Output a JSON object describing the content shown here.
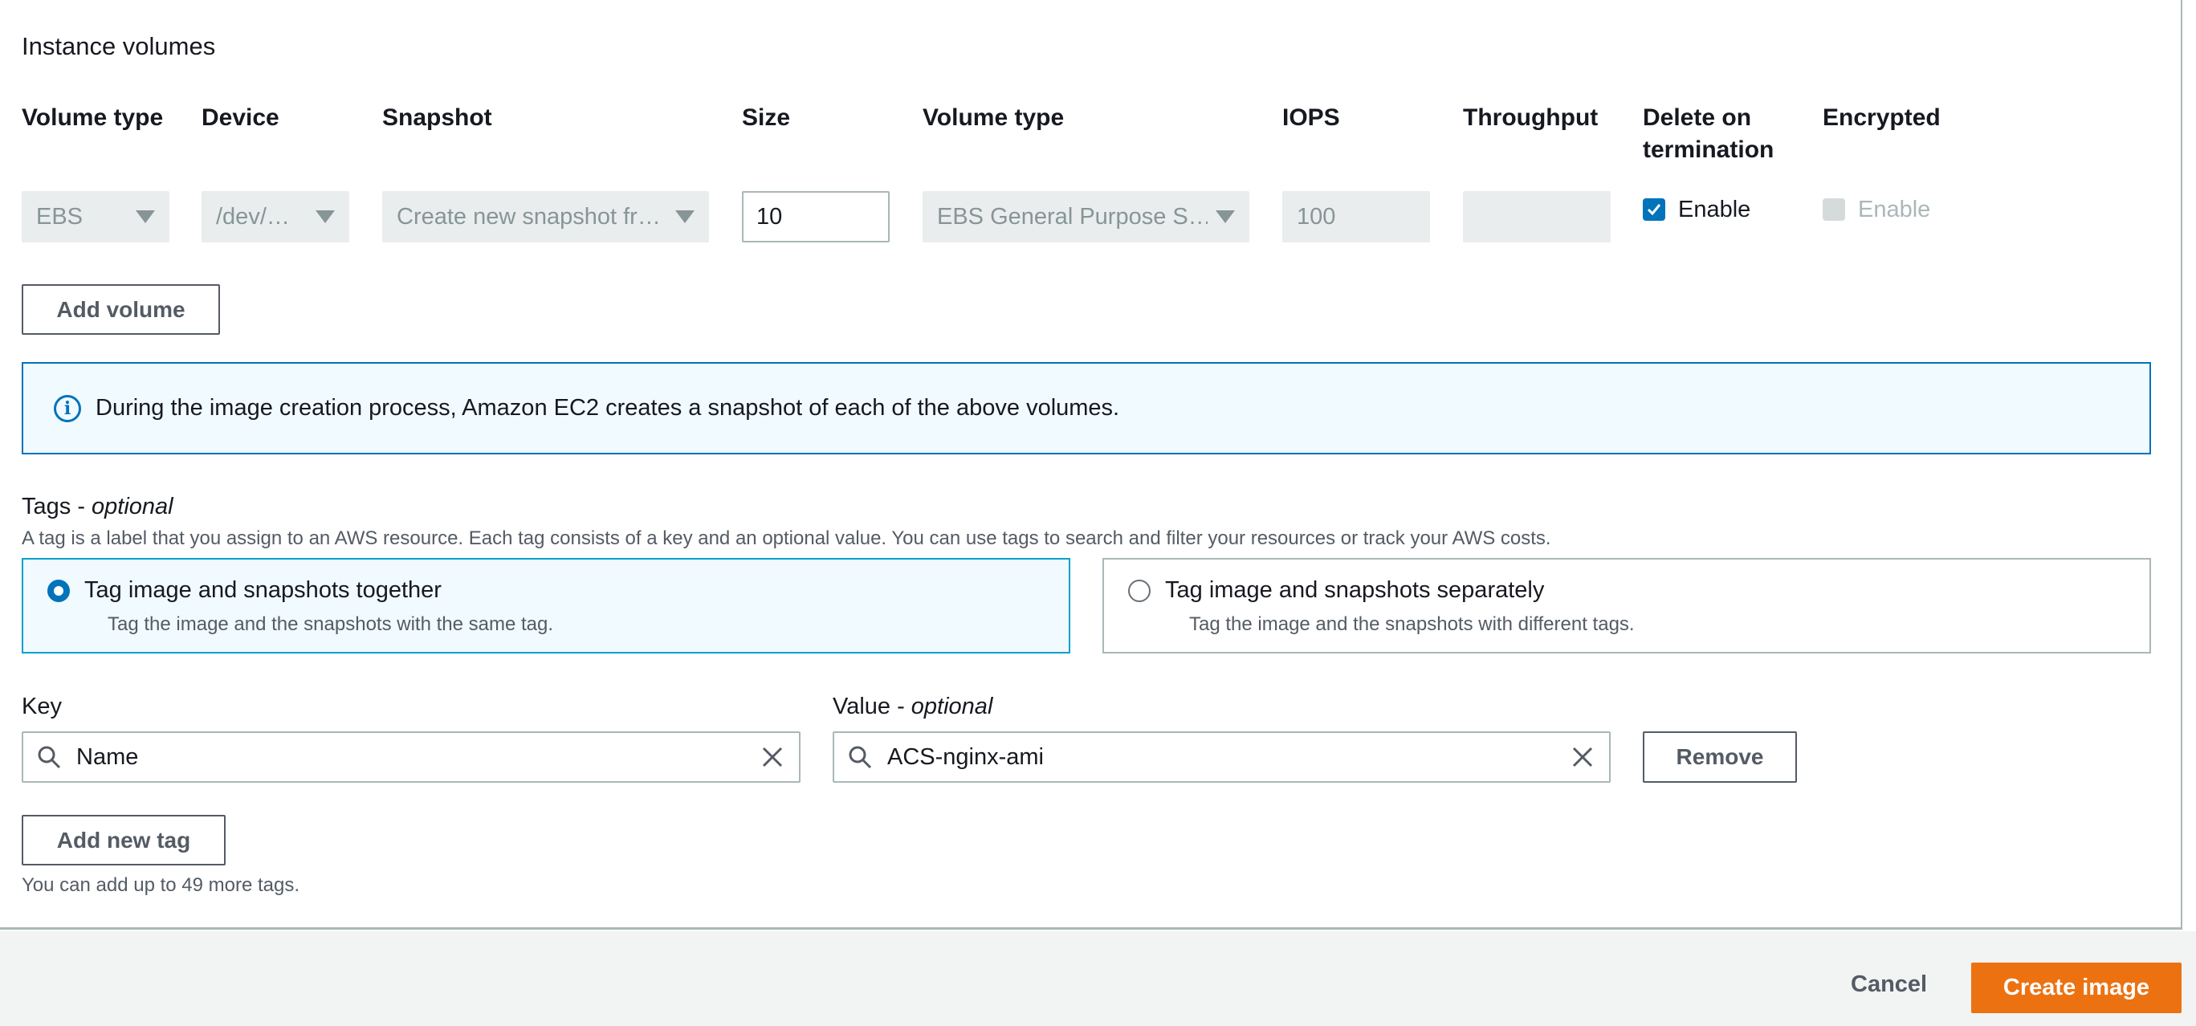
{
  "section": {
    "title": "Instance volumes"
  },
  "columns": {
    "volume_type": "Volume type",
    "device": "Device",
    "snapshot": "Snapshot",
    "size": "Size",
    "volume_type2": "Volume type",
    "iops": "IOPS",
    "throughput": "Throughput",
    "delete_on_termination": "Delete on termination",
    "encrypted": "Encrypted"
  },
  "volume_row": {
    "volume_type": "EBS",
    "device": "/dev/…",
    "snapshot": "Create new snapshot fr…",
    "size": "10",
    "ebs_type": "EBS General Purpose S…",
    "iops": "100",
    "throughput": "",
    "delete_on_termination": {
      "checked": true,
      "label": "Enable"
    },
    "encrypted": {
      "checked": false,
      "label": "Enable"
    }
  },
  "buttons": {
    "add_volume": "Add volume",
    "add_new_tag": "Add new tag",
    "remove": "Remove",
    "cancel": "Cancel",
    "create_image": "Create image"
  },
  "info": {
    "text": "During the image creation process, Amazon EC2 creates a snapshot of each of the above volumes."
  },
  "tags": {
    "title": "Tags - ",
    "title_optional": "optional",
    "description": "A tag is a label that you assign to an AWS resource. Each tag consists of a key and an optional value. You can use tags to search and filter your resources or track your AWS costs.",
    "options": [
      {
        "label": "Tag image and snapshots together",
        "sub": "Tag the image and the snapshots with the same tag.",
        "selected": true
      },
      {
        "label": "Tag image and snapshots separately",
        "sub": "Tag the image and the snapshots with different tags.",
        "selected": false
      }
    ],
    "key_label": "Key",
    "value_label": "Value - ",
    "value_optional": "optional",
    "key_value": "Name",
    "value_value": "ACS-nginx-ami",
    "helper": "You can add up to 49 more tags."
  },
  "colors": {
    "accent": "#0073bb",
    "primary": "#ec7211",
    "info_bg": "#f1faff"
  }
}
